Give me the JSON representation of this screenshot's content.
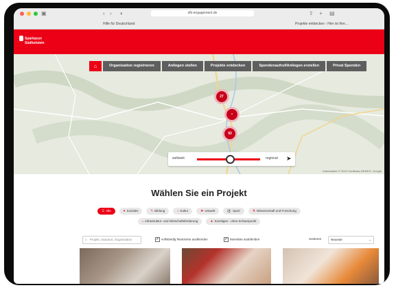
{
  "browser": {
    "url": "sfk-engagement.de",
    "tab_left": "Hilfe für Deutschland",
    "tab_right": "Projekte entdecken - Hier ist Ihre..."
  },
  "brand": {
    "line1": "Sparkasse",
    "line2": "Südholstein",
    "color": "#ec0016"
  },
  "nav": {
    "home_icon": "home-icon",
    "items": [
      "Organisation registrieren",
      "Anliegen stellen",
      "Projekte entdecken",
      "Spendenaufruf/Anliegen erstellen",
      "Privat Spenden"
    ]
  },
  "map": {
    "markers": [
      "27",
      "•",
      "93"
    ],
    "radius_left": "weltweit",
    "radius_right": "regional",
    "radius_value": 0.55,
    "attribution": "Kartendaten © 2023 GeoBasis-DE/BKG, Google"
  },
  "section": {
    "title": "Wählen Sie ein Projekt"
  },
  "categories_row1": [
    {
      "label": "Alle",
      "icon": "☰",
      "active": true
    },
    {
      "label": "Soziales",
      "icon": "♥",
      "active": false
    },
    {
      "label": "Bildung",
      "icon": "✎",
      "active": false
    },
    {
      "label": "Kultur",
      "icon": "♪",
      "active": false
    },
    {
      "label": "Umwelt",
      "icon": "☘",
      "active": false
    },
    {
      "label": "Sport",
      "icon": "⚽",
      "active": false
    },
    {
      "label": "Wissenschaft und Forschung",
      "icon": "⚗",
      "active": false
    }
  ],
  "categories_row2": [
    {
      "label": "Infrastruktur- und Wirtschaftsförderung",
      "icon": "⌂",
      "active": false
    },
    {
      "label": "Sonstiges - ohne Schwerpunkt",
      "icon": "★",
      "active": false
    }
  ],
  "filter": {
    "search_placeholder": "Projekt, Standort, Organisation",
    "check1": "vollständig finanzierte ausblenden",
    "check2": "beendete ausblenden",
    "sort_label": "Sortieren",
    "sort_value": "Neueste"
  }
}
